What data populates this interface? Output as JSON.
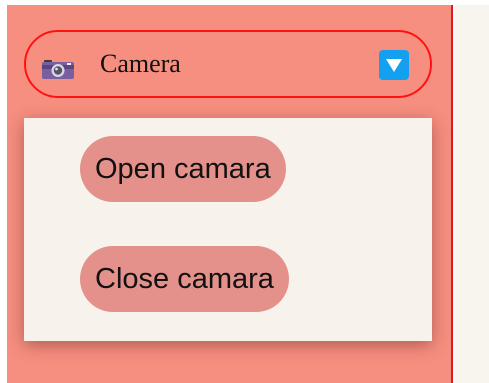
{
  "camera_toggle": {
    "label": "Camera",
    "icon": "camera-icon",
    "chevron_icon": "chevron-down-icon",
    "expanded": true
  },
  "dropdown": {
    "items": [
      {
        "label": "Open camara"
      },
      {
        "label": "Close camara"
      }
    ]
  },
  "colors": {
    "sidebar_bg": "#f78f80",
    "toggle_border": "#ff1212",
    "chevron_bg": "#14a0f0",
    "menu_bg": "#f7f3ec",
    "menu_item_bg": "#e3918a",
    "main_area_bg": "#f8f4ee",
    "divider": "#e8141b"
  }
}
